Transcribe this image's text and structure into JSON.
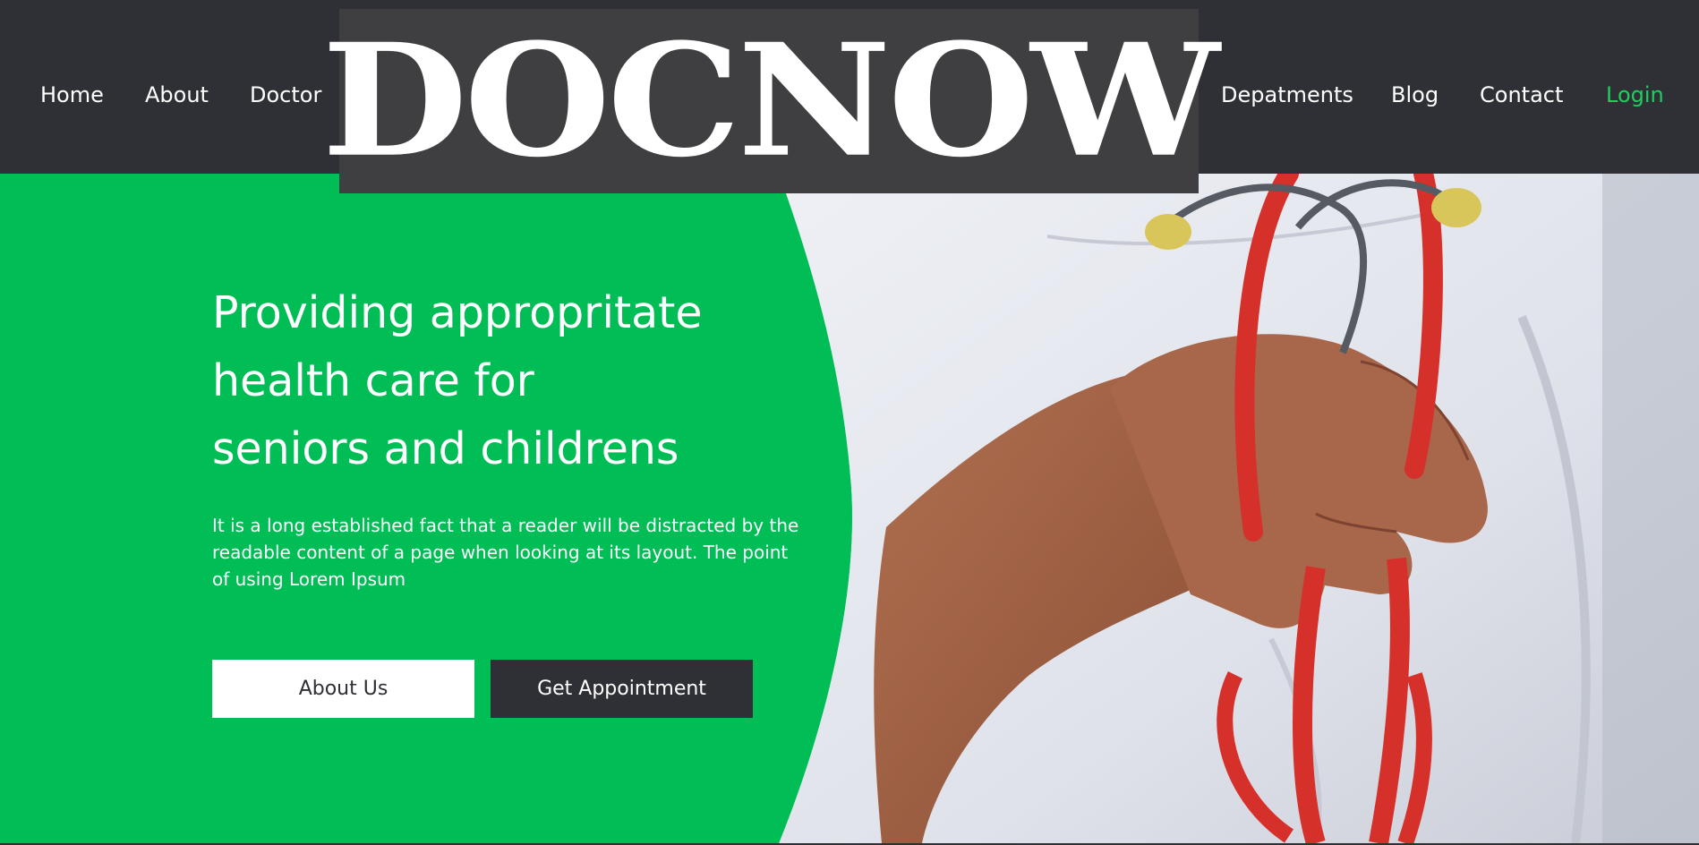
{
  "nav": {
    "home": "Home",
    "about": "About",
    "doctor": "Doctor",
    "departments": "Depatments",
    "blog": "Blog",
    "contact": "Contact",
    "login": "Login"
  },
  "logo": {
    "text": "DOCNOW"
  },
  "hero": {
    "title": "Providing appropritate\nhealth care for\nseniors and childrens",
    "text": "It is a long established fact that a reader will be distracted by the readable content of a page when looking at its layout. The point of using Lorem Ipsum",
    "about_button": "About Us",
    "appointment_button": "Get Appointment"
  },
  "colors": {
    "nav_background": "#2f3036",
    "logo_background": "#3f3f42",
    "hero_green": "#00bd55",
    "login_green": "#1fce5e",
    "dark_button": "#2f3036"
  }
}
